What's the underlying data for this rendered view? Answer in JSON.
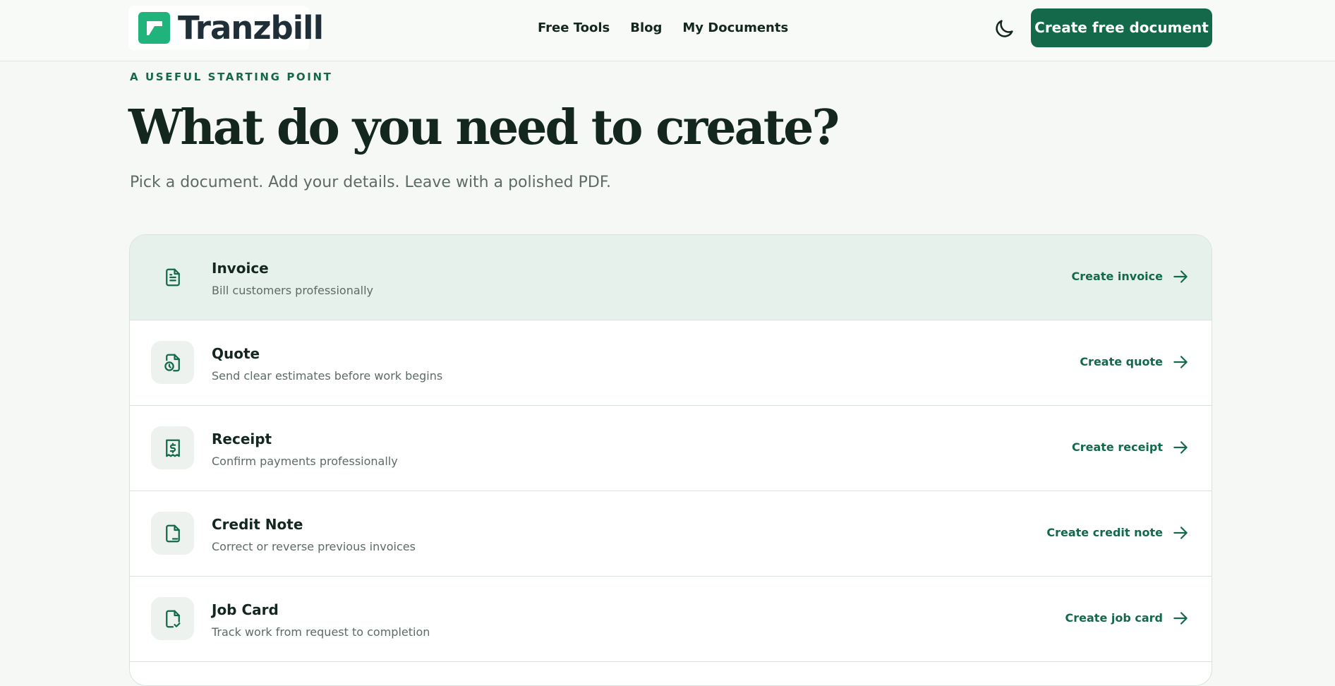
{
  "header": {
    "brand": "Tranzbill",
    "nav": [
      {
        "label": "Free Tools"
      },
      {
        "label": "Blog"
      },
      {
        "label": "My Documents"
      }
    ],
    "theme_toggle_icon": "moon-icon",
    "cta_label": "Create free document"
  },
  "hero": {
    "eyebrow": "A USEFUL STARTING POINT",
    "title": "What do you need to create?",
    "subtitle": "Pick a document. Add your details. Leave with a polished PDF."
  },
  "documents": [
    {
      "title": "Invoice",
      "description": "Bill customers professionally",
      "action": "Create invoice",
      "icon": "document-text-icon",
      "active": true
    },
    {
      "title": "Quote",
      "description": "Send clear estimates before work begins",
      "action": "Create quote",
      "icon": "document-clock-icon",
      "active": false
    },
    {
      "title": "Receipt",
      "description": "Confirm payments professionally",
      "action": "Create receipt",
      "icon": "receipt-dollar-icon",
      "active": false
    },
    {
      "title": "Credit Note",
      "description": "Correct or reverse previous invoices",
      "action": "Create credit note",
      "icon": "document-minus-icon",
      "active": false
    },
    {
      "title": "Job Card",
      "description": "Track work from request to completion",
      "action": "Create job card",
      "icon": "document-check-icon",
      "active": false
    }
  ],
  "colors": {
    "accent": "#13694a",
    "logo_green": "#20b47c",
    "active_row": "#e6f1eb",
    "background": "#f6f8f6"
  }
}
